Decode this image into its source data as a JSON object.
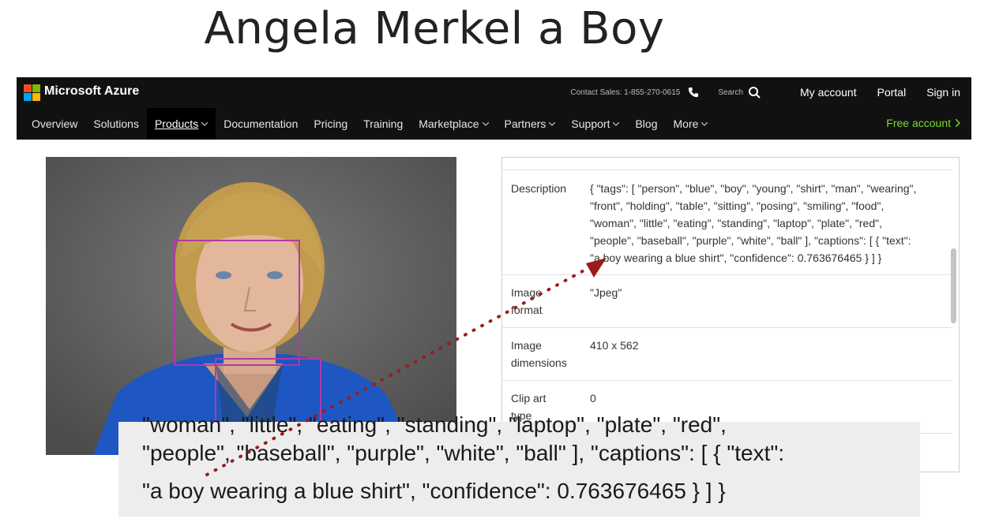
{
  "slide": {
    "title": "Angela Merkel a Boy"
  },
  "azure": {
    "brand": "Microsoft Azure",
    "contact": "Contact Sales: 1-855-270-0615",
    "search_label": "Search",
    "my_account": "My account",
    "portal": "Portal",
    "sign_in": "Sign in",
    "nav": {
      "overview": "Overview",
      "solutions": "Solutions",
      "products": "Products",
      "documentation": "Documentation",
      "pricing": "Pricing",
      "training": "Training",
      "marketplace": "Marketplace",
      "partners": "Partners",
      "support": "Support",
      "blog": "Blog",
      "more": "More"
    },
    "free_account": "Free account",
    "colors": {
      "bar": "#111111",
      "free": "#7bd832",
      "logo": [
        "#f25022",
        "#7fba00",
        "#00a4ef",
        "#ffb900"
      ]
    }
  },
  "result": {
    "description_label": "Description",
    "description_lines": [
      "{ \"tags\": [ \"person\", \"blue\", \"boy\", \"young\", \"shirt\", \"man\", \"wearing\",",
      "\"front\", \"holding\", \"table\", \"sitting\", \"posing\", \"smiling\", \"food\",",
      "\"woman\", \"little\", \"eating\", \"standing\", \"laptop\", \"plate\", \"red\",",
      "\"people\", \"baseball\", \"purple\", \"white\", \"ball\" ], \"captions\": [ { \"text\":",
      "\"a boy wearing a blue shirt\", \"confidence\": 0.763676465 } ] }"
    ],
    "format_label_1": "Image",
    "format_label_2": "format",
    "format_value": "\"Jpeg\"",
    "dims_label_1": "Image",
    "dims_label_2": "dimensions",
    "dims_value": "410 x 562",
    "clipart_label_1": "Clip art",
    "clipart_label_2": "type",
    "clipart_value": "0"
  },
  "zoom": {
    "line0": "\"woman\", \"little\", \"eating\", \"standing\", \"laptop\", \"plate\", \"red\",",
    "line1": "\"people\", \"baseball\", \"purple\", \"white\", \"ball\" ], \"captions\": [ { \"text\":",
    "line2": "\"a boy wearing a blue shirt\", \"confidence\": 0.763676465 } ] }"
  }
}
